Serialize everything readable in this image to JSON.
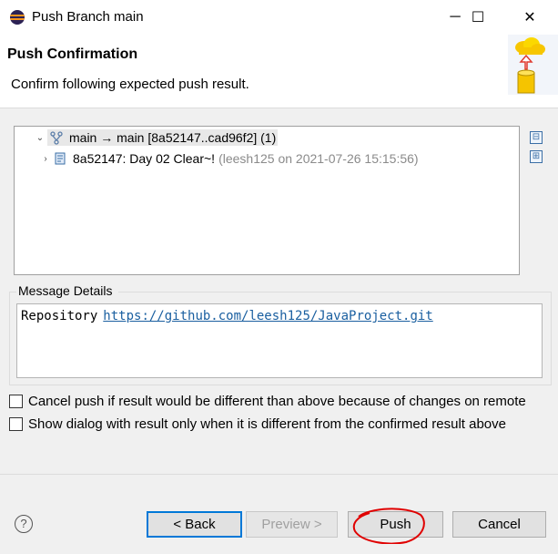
{
  "window": {
    "title": "Push Branch main",
    "minimize_glyph": "─",
    "maximize_glyph": "☐",
    "close_glyph": "✕"
  },
  "header": {
    "title": "Push Confirmation",
    "message": "Confirm following expected push result.",
    "banner_icon": "cloud-push-icon"
  },
  "tree": {
    "root": {
      "expander": "⌄",
      "icon": "branch-icon",
      "label": "main → main [8a52147..cad96f2] (1)"
    },
    "commit": {
      "expander": "›",
      "icon": "commit-icon",
      "label": "8a52147: Day 02 Clear~!",
      "meta": "(leesh125 on 2021-07-26 15:15:56)"
    },
    "collapse_all": "⊟",
    "expand_all": "⊞"
  },
  "message_details": {
    "group_label": "Message Details",
    "repository_label": "Repository",
    "repository_url": "https://github.com/leesh125/JavaProject.git"
  },
  "options": {
    "cancel_if_different": {
      "label": "Cancel push if result would be different than above because of changes on remote",
      "checked": false
    },
    "show_dialog_only_if_different": {
      "label": "Show dialog with result only when it is different from the confirmed result above",
      "checked": false
    }
  },
  "buttons": {
    "help": "?",
    "back": "< Back",
    "preview": "Preview >",
    "push": "Push",
    "cancel": "Cancel"
  },
  "colors": {
    "annotation": "#e00000",
    "link": "#1a5fa0",
    "default_button_border": "#0078d7"
  }
}
